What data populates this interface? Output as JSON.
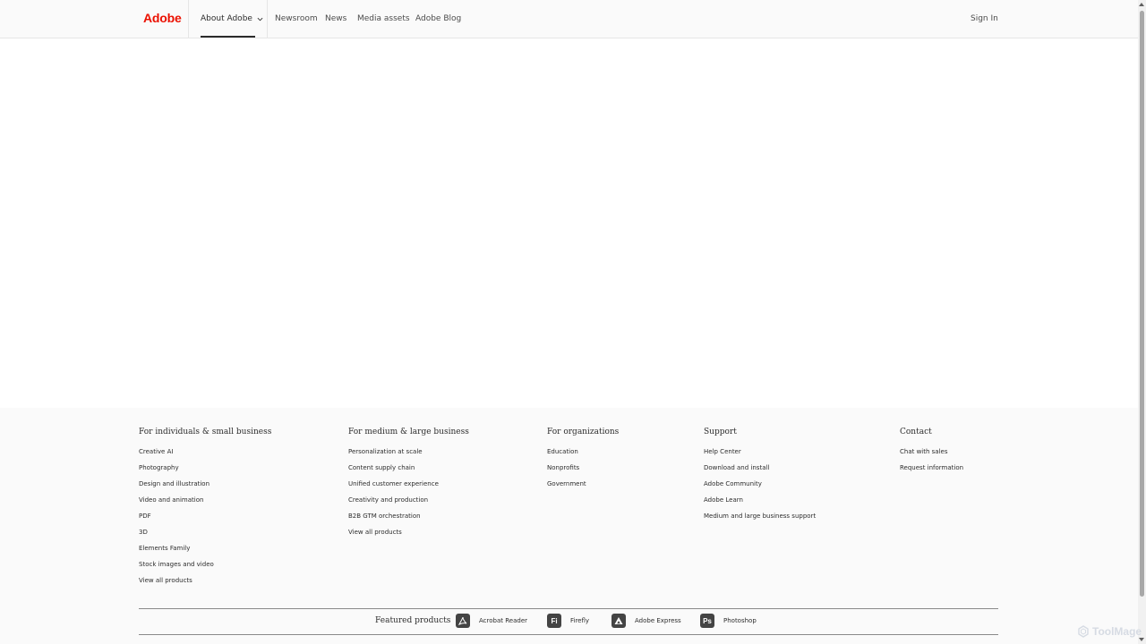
{
  "header": {
    "logo": "Adobe",
    "about_label": "About Adobe",
    "nav": [
      "Newsroom",
      "News",
      "Media assets",
      "Adobe Blog"
    ],
    "signin": "Sign In"
  },
  "footer": {
    "columns": [
      {
        "title": "For individuals & small business",
        "links": [
          "Creative AI",
          "Photography",
          "Design and illustration",
          "Video and animation",
          "PDF",
          "3D",
          "Elements Family",
          "Stock images and video",
          "View all products"
        ]
      },
      {
        "title": "For medium & large business",
        "links": [
          "Personalization at scale",
          "Content supply chain",
          "Unified customer experience",
          "Creativity and production",
          "B2B GTM orchestration",
          "View all products"
        ]
      },
      {
        "title": "For organizations",
        "links": [
          "Education",
          "Nonprofits",
          "Government"
        ]
      },
      {
        "title": "Support",
        "links": [
          "Help Center",
          "Download and install",
          "Adobe Community",
          "Adobe Learn",
          "Medium and large business support"
        ]
      },
      {
        "title": "Contact",
        "links": [
          "Chat with sales",
          "Request information"
        ]
      }
    ],
    "featured": {
      "title": "Featured products",
      "products": [
        {
          "icon_name": "acrobat-reader-icon",
          "glyph": "",
          "label": "Acrobat Reader"
        },
        {
          "icon_name": "firefly-icon",
          "glyph": "Fi",
          "label": "Firefly"
        },
        {
          "icon_name": "adobe-express-icon",
          "glyph": "",
          "label": "Adobe Express"
        },
        {
          "icon_name": "photoshop-icon",
          "glyph": "Ps",
          "label": "Photoshop"
        }
      ]
    }
  },
  "watermark": "ToolMage",
  "colors": {
    "brand": "#eb1000",
    "footer_bg": "#fafafa",
    "text": "#2c2c2c"
  }
}
